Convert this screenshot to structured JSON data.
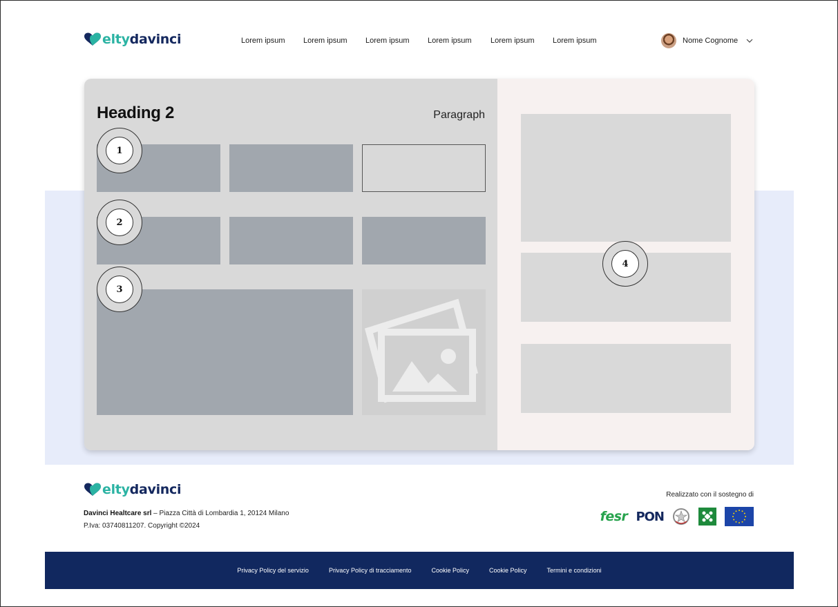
{
  "header": {
    "logo": {
      "part1": "elty",
      "part2": "davinci"
    },
    "nav": [
      "Lorem ipsum",
      "Lorem ipsum",
      "Lorem ipsum",
      "Lorem ipsum",
      "Lorem ipsum",
      "Lorem ipsum"
    ],
    "user": {
      "name": "Nome Cognome"
    }
  },
  "card": {
    "heading": "Heading 2",
    "paragraph": "Paragraph",
    "markers": [
      "1",
      "2",
      "3",
      "4"
    ]
  },
  "footer": {
    "logo": {
      "part1": "elty",
      "part2": "davinci"
    },
    "company_name": "Davinci Healtcare srl",
    "address": " – Piazza Città di Lombardia 1, 20124 Milano",
    "vat": "P.Iva: 03740811207. Copyright ©2024",
    "support_label": "Realizzato con il sostegno di",
    "partners": {
      "fesr": "fesr",
      "pon": "PON"
    }
  },
  "bottom_links": [
    "Privacy Policy del servizio",
    "Privacy Policy di tracciamento",
    "Cookie Policy",
    "Cookie Policy",
    "Termini e condizioni"
  ],
  "colors": {
    "brand_teal": "#2bb3a3",
    "brand_navy": "#14285e",
    "footer_bar": "#11285f",
    "hero_band": "#e7ecfa"
  }
}
